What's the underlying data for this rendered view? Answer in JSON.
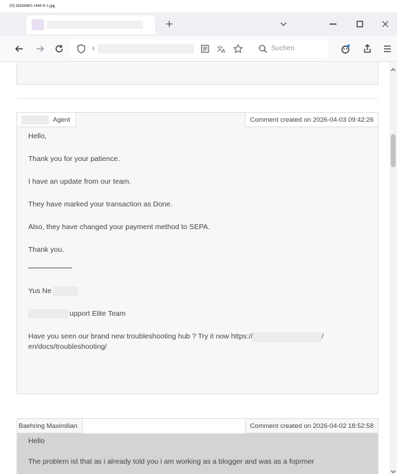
{
  "caption": "[0] 20260403-1445-0-1.jpg",
  "browser": {
    "new_tab_symbol": "+",
    "url_prefix": "ı",
    "search_placeholder": "Suchen"
  },
  "icons": {
    "back": "arrow-left-icon",
    "forward": "arrow-right-icon",
    "reload": "reload-icon",
    "shield": "shield-icon",
    "reader": "reader-view-icon",
    "translate": "translate-icon",
    "bookmark": "star-icon",
    "search": "search-icon",
    "extensions": "extension-icon",
    "share": "share-icon",
    "menu": "hamburger-menu-icon"
  },
  "comments": [
    {
      "author": "Agent",
      "created": "Comment created on 2026-04-03 09:42:26",
      "lines": [
        "Hello,",
        "Thank you for your patience.",
        "I have an update from our team.",
        "They have marked your transaction as Done.",
        "Also, they have changed your payment method to SEPA.",
        "Thank you."
      ],
      "sig_name": "Yus Ne",
      "sig_team": "upport Elite Team",
      "hub_text_1": "Have you seen our brand new troubleshooting hub ? Try it now https://",
      "hub_text_2": "/",
      "hub_text_3": "en/docs/troubleshooting/"
    },
    {
      "author": "Baehring Maximilian",
      "created": "Comment created on 2026-04-02 18:52:58",
      "lines": [
        "Hello",
        "The problem ist that as i already told you i am working as a blogger and was as a foprmer"
      ]
    }
  ],
  "colors": {
    "chrome_bg": "#f0f0f4",
    "comment_bg": "#f7f7f7",
    "comment_alt_bg": "#d4d4d4",
    "border": "#dddddd"
  }
}
